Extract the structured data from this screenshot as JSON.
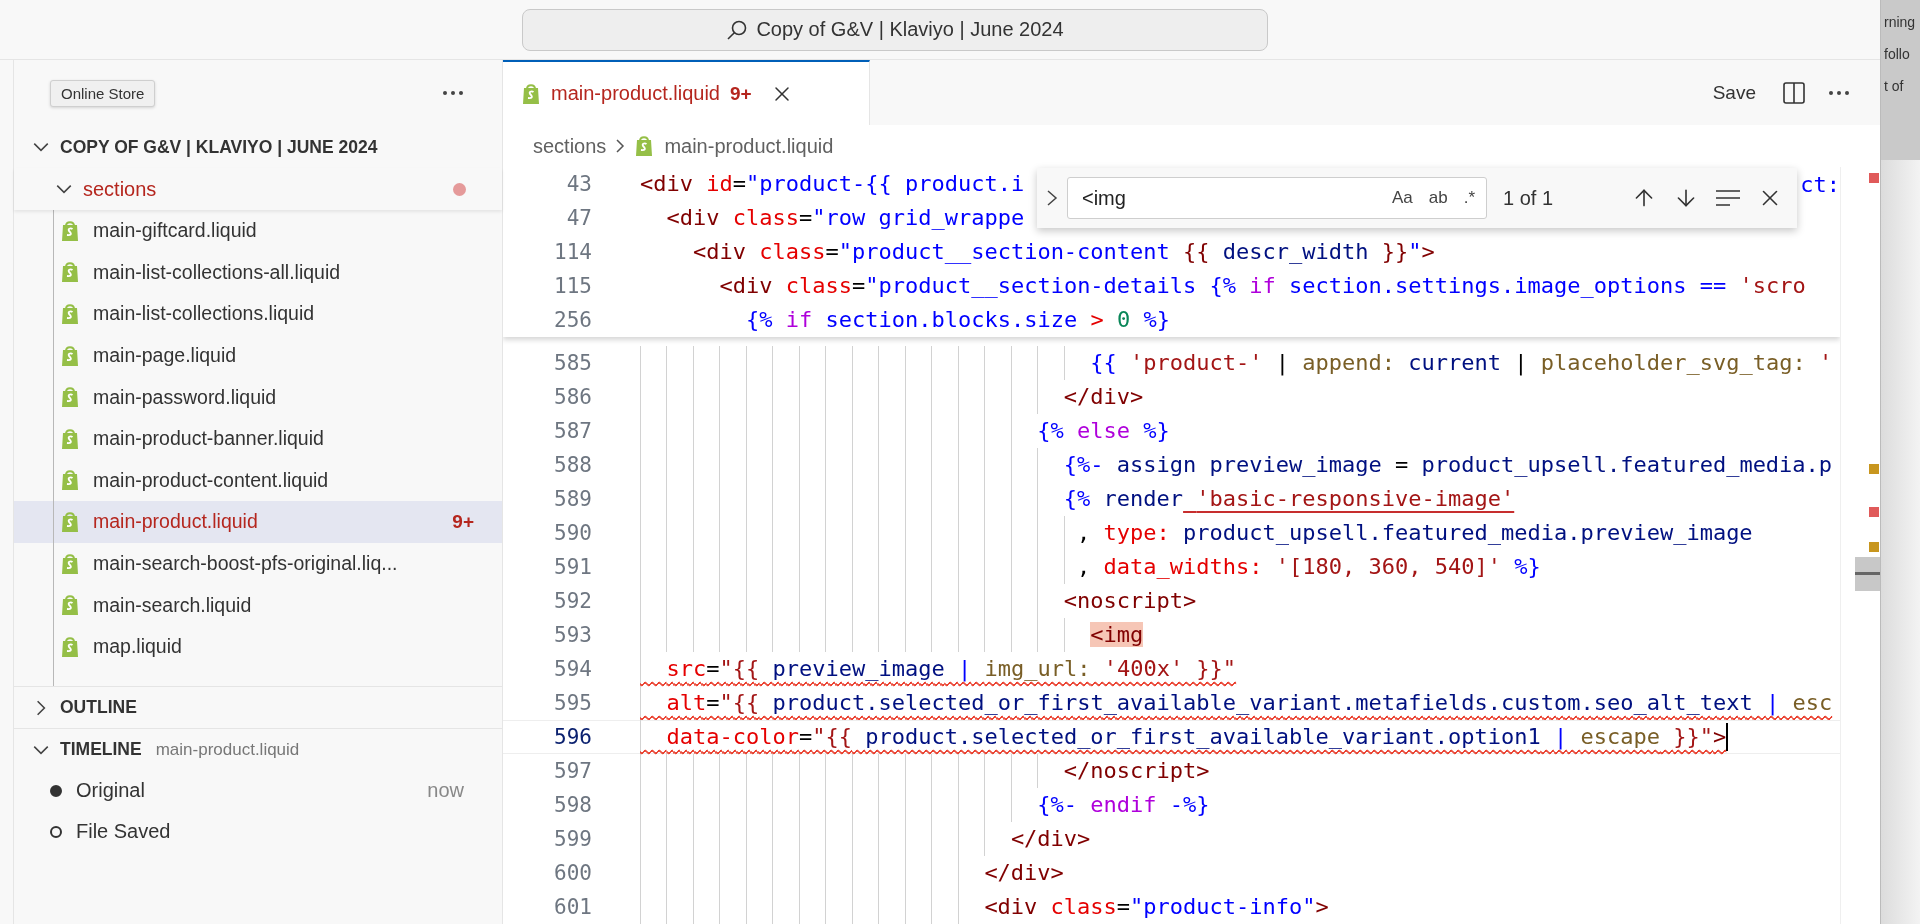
{
  "title_bar": {
    "search": "Copy of G&V | Klaviyo | June 2024"
  },
  "sidebar": {
    "badge": "Online Store",
    "workspace": {
      "title": "COPY OF G&V | KLAVIYO | JUNE 2024",
      "expanded": true
    },
    "folder": {
      "name": "sections",
      "expanded": true,
      "has_problems": true
    },
    "files": [
      {
        "name": "main-giftcard.liquid",
        "selected": false
      },
      {
        "name": "main-list-collections-all.liquid",
        "selected": false
      },
      {
        "name": "main-list-collections.liquid",
        "selected": false
      },
      {
        "name": "main-page.liquid",
        "selected": false
      },
      {
        "name": "main-password.liquid",
        "selected": false
      },
      {
        "name": "main-product-banner.liquid",
        "selected": false
      },
      {
        "name": "main-product-content.liquid",
        "selected": false
      },
      {
        "name": "main-product.liquid",
        "selected": true,
        "problems": "9+"
      },
      {
        "name": "main-search-boost-pfs-original.liq...",
        "selected": false
      },
      {
        "name": "main-search.liquid",
        "selected": false
      },
      {
        "name": "map.liquid",
        "selected": false
      }
    ],
    "outline": {
      "title": "OUTLINE",
      "expanded": false
    },
    "timeline": {
      "title": "TIMELINE",
      "file": "main-product.liquid",
      "expanded": true,
      "entries": [
        {
          "label": "Original",
          "time": "now",
          "kind": "filled"
        },
        {
          "label": "File Saved",
          "kind": "hollow"
        }
      ]
    }
  },
  "tabs": [
    {
      "label": "main-product.liquid",
      "problems": "9+",
      "selected": true
    }
  ],
  "editor_actions": {
    "save": "Save"
  },
  "breadcrumb": [
    {
      "kind": "folder",
      "label": "sections"
    },
    {
      "kind": "file",
      "label": "main-product.liquid"
    }
  ],
  "sticky_lines": [
    {
      "number": "43",
      "tokens": [
        {
          "kind": "tag",
          "text": "<div"
        },
        {
          "kind": "attr",
          "text": " id"
        },
        {
          "kind": "punct",
          "text": "="
        },
        {
          "kind": "str",
          "text": "\"product-{{ product.i"
        }
      ],
      "tail": "ct:"
    },
    {
      "number": "47",
      "tokens": [
        {
          "kind": "tag",
          "text": "  <div"
        },
        {
          "kind": "attr",
          "text": " class"
        },
        {
          "kind": "punct",
          "text": "="
        },
        {
          "kind": "str",
          "text": "\"row grid_wrappe"
        }
      ]
    },
    {
      "number": "114",
      "tokens": [
        {
          "kind": "tag",
          "text": "    <div"
        },
        {
          "kind": "attr",
          "text": " class"
        },
        {
          "kind": "punct",
          "text": "="
        },
        {
          "kind": "str",
          "text": "\"product__section-content "
        },
        {
          "kind": "tag",
          "text": "{{"
        },
        {
          "kind": "var",
          "text": " descr_width "
        },
        {
          "kind": "tag",
          "text": "}}"
        },
        {
          "kind": "str",
          "text": "\""
        },
        {
          "kind": "tag",
          "text": ">"
        }
      ]
    },
    {
      "number": "115",
      "tokens": [
        {
          "kind": "tag",
          "text": "      <div"
        },
        {
          "kind": "attr",
          "text": " class"
        },
        {
          "kind": "punct",
          "text": "="
        },
        {
          "kind": "str",
          "text": "\"product__section-details "
        },
        {
          "kind": "delim",
          "text": "{%"
        },
        {
          "kind": "kw",
          "text": " if"
        },
        {
          "kind": "op",
          "text": " section.settings.image_options"
        },
        {
          "kind": "op",
          "text": " =="
        },
        {
          "kind": "lit",
          "text": " 'scro"
        }
      ]
    },
    {
      "number": "256",
      "tokens": [
        {
          "kind": "delim",
          "text": "        {%"
        },
        {
          "kind": "kw",
          "text": " if"
        },
        {
          "kind": "op",
          "text": " section.blocks.size"
        },
        {
          "kind": "cmp",
          "text": " >"
        },
        {
          "kind": "num",
          "text": " 0"
        },
        {
          "kind": "delim",
          "text": " %}"
        }
      ]
    }
  ],
  "lines": [
    {
      "number": "585",
      "error": false,
      "current": false,
      "tokens": [
        {
          "kind": "delim",
          "text": "                                  {{"
        },
        {
          "kind": "lit",
          "text": " 'product-'"
        },
        {
          "kind": "punct",
          "text": " |"
        },
        {
          "kind": "filter",
          "text": " append:"
        },
        {
          "kind": "var",
          "text": " current"
        },
        {
          "kind": "punct",
          "text": " |"
        },
        {
          "kind": "filter",
          "text": " placeholder_svg_tag:"
        },
        {
          "kind": "lit",
          "text": " '"
        }
      ]
    },
    {
      "number": "586",
      "error": false,
      "current": false,
      "tokens": [
        {
          "kind": "tag",
          "text": "                                </div>"
        }
      ]
    },
    {
      "number": "587",
      "error": false,
      "current": false,
      "tokens": [
        {
          "kind": "delim",
          "text": "                              {%"
        },
        {
          "kind": "kw",
          "text": " else"
        },
        {
          "kind": "delim",
          "text": " %}"
        }
      ]
    },
    {
      "number": "588",
      "error": false,
      "current": false,
      "tokens": [
        {
          "kind": "delim",
          "text": "                                {%-"
        },
        {
          "kind": "var",
          "text": " assign preview_image"
        },
        {
          "kind": "punct",
          "text": " ="
        },
        {
          "kind": "var",
          "text": " product_upsell.featured_media.p"
        }
      ]
    },
    {
      "number": "589",
      "error": false,
      "current": false,
      "tokens": [
        {
          "kind": "delim",
          "text": "                                {%"
        },
        {
          "kind": "var",
          "text": " render"
        },
        {
          "kind": "link",
          "text": " 'basic-responsive-image'"
        }
      ]
    },
    {
      "number": "590",
      "error": false,
      "current": false,
      "tokens": [
        {
          "kind": "punct",
          "text": "                                 ,"
        },
        {
          "kind": "attr",
          "text": " type:"
        },
        {
          "kind": "var",
          "text": " product_upsell.featured_media.preview_image"
        }
      ]
    },
    {
      "number": "591",
      "error": false,
      "current": false,
      "tokens": [
        {
          "kind": "punct",
          "text": "                                 ,"
        },
        {
          "kind": "attr",
          "text": " data_widths:"
        },
        {
          "kind": "lit",
          "text": " '[180, 360, 540]'"
        },
        {
          "kind": "delim",
          "text": " %}"
        }
      ]
    },
    {
      "number": "592",
      "error": false,
      "current": false,
      "tokens": [
        {
          "kind": "tag",
          "text": "                                <noscript>"
        }
      ]
    },
    {
      "number": "593",
      "error": false,
      "current": false,
      "tokens": [
        {
          "kind": "match",
          "text": "                                  <img"
        }
      ]
    },
    {
      "number": "594",
      "error": true,
      "current": false,
      "tokens": [
        {
          "kind": "attr",
          "text": "  src"
        },
        {
          "kind": "punct",
          "text": "="
        },
        {
          "kind": "lit",
          "text": "\"{{"
        },
        {
          "kind": "var",
          "text": " preview_image"
        },
        {
          "kind": "op",
          "text": " |"
        },
        {
          "kind": "filter",
          "text": " img_url:"
        },
        {
          "kind": "lit",
          "text": " '400x' }}\""
        }
      ]
    },
    {
      "number": "595",
      "error": true,
      "current": false,
      "tokens": [
        {
          "kind": "attr",
          "text": "  alt"
        },
        {
          "kind": "punct",
          "text": "="
        },
        {
          "kind": "lit",
          "text": "\"{{"
        },
        {
          "kind": "var",
          "text": " product.selected_or_first_available_variant.metafields.custom.seo_alt_text"
        },
        {
          "kind": "op",
          "text": " |"
        },
        {
          "kind": "filter",
          "text": " esc"
        }
      ]
    },
    {
      "number": "596",
      "error": true,
      "current": true,
      "tokens": [
        {
          "kind": "attr",
          "text": "  data-color"
        },
        {
          "kind": "punct",
          "text": "="
        },
        {
          "kind": "lit",
          "text": "\"{{"
        },
        {
          "kind": "var",
          "text": " product.selected_or_first_available_variant.option1"
        },
        {
          "kind": "op",
          "text": " |"
        },
        {
          "kind": "filter",
          "text": " escape"
        },
        {
          "kind": "lit",
          "text": " }}\""
        },
        {
          "kind": "tag",
          "text": ">"
        }
      ]
    },
    {
      "number": "597",
      "error": false,
      "current": false,
      "tokens": [
        {
          "kind": "tag",
          "text": "                                </noscript>"
        }
      ]
    },
    {
      "number": "598",
      "error": false,
      "current": false,
      "tokens": [
        {
          "kind": "delim",
          "text": "                              {%-"
        },
        {
          "kind": "kw",
          "text": " endif"
        },
        {
          "kind": "delim",
          "text": " -%}"
        }
      ]
    },
    {
      "number": "599",
      "error": false,
      "current": false,
      "tokens": [
        {
          "kind": "tag",
          "text": "                            </div>"
        }
      ]
    },
    {
      "number": "600",
      "error": false,
      "current": false,
      "tokens": [
        {
          "kind": "tag",
          "text": "                          </div>"
        }
      ]
    },
    {
      "number": "601",
      "error": false,
      "current": false,
      "tokens": [
        {
          "kind": "tag",
          "text": "                          <div"
        },
        {
          "kind": "attr",
          "text": " class"
        },
        {
          "kind": "punct",
          "text": "="
        },
        {
          "kind": "str",
          "text": "\"product-info\""
        },
        {
          "kind": "tag",
          "text": ">"
        }
      ]
    }
  ],
  "find": {
    "query": "<img",
    "options": [
      "Aa",
      "ab",
      ".*"
    ],
    "result": "1 of 1"
  },
  "background_window": {
    "texts": [
      "rning",
      "follo",
      "t of"
    ]
  }
}
